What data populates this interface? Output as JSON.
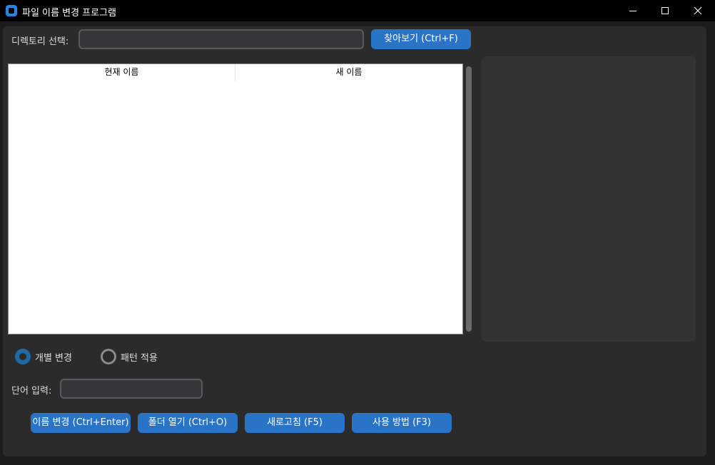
{
  "window": {
    "title": "파일 이름 변경 프로그램"
  },
  "directory": {
    "label": "디렉토리 선택:",
    "value": "",
    "browse_button": "찾아보기 (Ctrl+F)"
  },
  "table": {
    "columns": [
      "현재 이름",
      "새 이름"
    ],
    "rows": []
  },
  "mode": {
    "options": [
      "개별 변경",
      "패턴 적용"
    ],
    "selected": "개별 변경"
  },
  "word_input": {
    "label": "단어 입력:",
    "value": ""
  },
  "actions": {
    "rename": "이름 변경 (Ctrl+Enter)",
    "open_folder": "폴더 열기 (Ctrl+O)",
    "refresh": "새로고침 (F5)",
    "help": "사용 방법 (F3)"
  },
  "colors": {
    "accent": "#2a74c7",
    "titlebar": "#000000",
    "frame": "#2b2b2b"
  },
  "icons": {
    "app": "app-icon",
    "minimize": "minimize-icon",
    "maximize": "maximize-icon",
    "close": "close-icon"
  }
}
